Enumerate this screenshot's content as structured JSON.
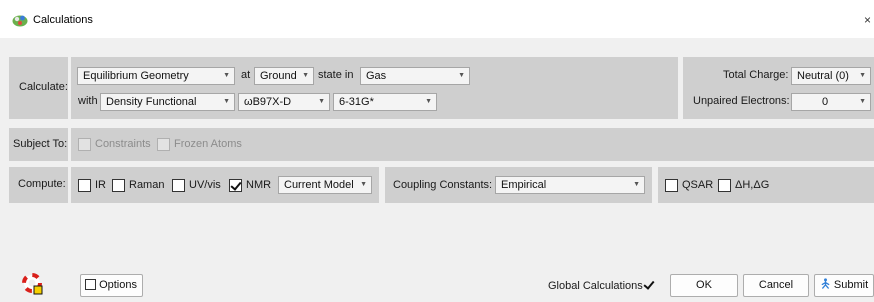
{
  "window": {
    "title": "Calculations",
    "close_glyph": "×",
    "app_icon": "spartan-molecule-icon"
  },
  "calculate": {
    "label": "Calculate:",
    "calculation_type": "Equilibrium Geometry",
    "at_label": "at",
    "state": "Ground",
    "state_in_label": "state in",
    "medium": "Gas",
    "with_label": "with",
    "method": "Density Functional",
    "functional": "ωB97X-D",
    "basis_set": "6-31G*"
  },
  "charge": {
    "total_charge_label": "Total Charge:",
    "total_charge_value": "Neutral (0)",
    "unpaired_label": "Unpaired Electrons:",
    "unpaired_value": "0"
  },
  "subject_to": {
    "label": "Subject To:",
    "constraints_label": "Constraints",
    "constraints_checked": false,
    "frozen_atoms_label": "Frozen Atoms",
    "frozen_atoms_checked": false
  },
  "compute": {
    "label": "Compute:",
    "ir_label": "IR",
    "ir_checked": false,
    "raman_label": "Raman",
    "raman_checked": false,
    "uvvis_label": "UV/vis",
    "uvvis_checked": false,
    "nmr_label": "NMR",
    "nmr_checked": true,
    "nmr_model": "Current Model",
    "coupling_label": "Coupling Constants:",
    "coupling_value": "Empirical",
    "qsar_label": "QSAR",
    "qsar_checked": false,
    "delta_label": "ΔH,ΔG",
    "delta_checked": false
  },
  "footer": {
    "options_label": "Options",
    "options_checked": false,
    "global_calculations_label": "Global Calculations",
    "global_calculations_checked": true,
    "ok_label": "OK",
    "cancel_label": "Cancel",
    "submit_label": "Submit",
    "submit_icon": "submit-figure-icon",
    "help_icon": "lifebuoy-help-icon"
  },
  "colors": {
    "panel": "#cfcfcf",
    "background": "#f0f0f0",
    "submit_icon": "#2f7fd8",
    "lifebuoy_red": "#d9201b",
    "lifebuoy_yellow": "#f6d000"
  }
}
